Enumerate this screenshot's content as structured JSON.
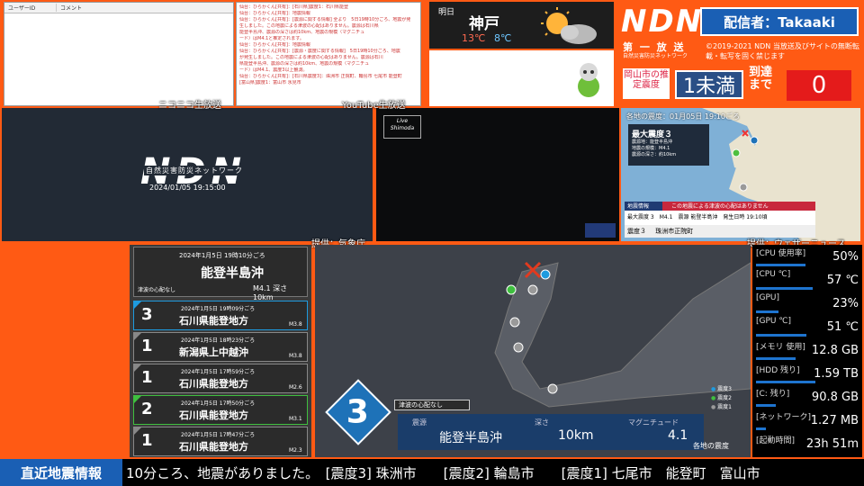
{
  "comments": {
    "col_user": "ユーザーID",
    "col_comment": "コメント"
  },
  "log": [
    "仙台：ひらかくん[共有]：[石川県]震度1：石川県能登",
    "仙台：ひらかくん[共有]：地震情報",
    "仙台：ひらかくん[共有]：[震源に関する情報] 全より　5日19時10分ごろ、地震が発",
    "生しました。この地震による津波の心配はありません。震源は石川県",
    "能登半島沖、震源の深さは約10km、地震の規模（マグニチュ",
    "ード）はM4.1と推定されます。",
    "仙台：ひらかくん[共有]：地震情報",
    "仙台：ひらかくん[共有]：[震源・震度に関する情報]　5日19時10分ごろ、地震",
    "が発生しました。この地震による津波の心配はありません。震源は石川",
    "県能登半島沖、震源の深さは約10km、地震の規模（マグニチュ",
    "ード）はM4.1、震度3以上観測。",
    "仙台：ひらかくん[共有]：[石川県震度3]：珠洲市 正院町、輪島市 七尾市 能登町",
    "[富山県]震度1：富山市 氷見市"
  ],
  "weather": {
    "day": "明日",
    "city": "神戸",
    "high": "13℃",
    "low": "8℃",
    "icon": "sun-cloud-icon"
  },
  "brand": {
    "logo": "NDN",
    "caster": "配信者：Takaaki",
    "daiichi": "第 一 放 送",
    "daiichi_sub": "自然災害防災ネットワーク",
    "copyright": "©2019-2021 NDN 当放送及びサイトの無断転載・転写を固く禁じます",
    "pref_label": "岡山市の推定震度",
    "est_intensity": "1未満",
    "arrival_label": "到達まで",
    "arrival_count": "0"
  },
  "labels": {
    "niconico": "ニコニコ生放送",
    "youtube": "YouTube生放送",
    "jma_credit": "提供：気象庁",
    "wni_credit": "提供：ウェザーニュース"
  },
  "niconico": {
    "logo": "NDN",
    "subtitle": "自然災害防災ネットワーク",
    "datetime": "2024/01/05 19:15:00"
  },
  "youtube": {
    "badge": "Live Shimoda"
  },
  "map": {
    "title": "各地の震度：01月05日 19:10ごろ",
    "max_label": "最大震度３",
    "epicenter": "震源地：能登半島沖",
    "magnitude": "地震の規模：M4.1",
    "depth": "震源の深さ：約10km",
    "ticker_head": "地震情報",
    "ticker_msg": "この地震による津波の心配はありません",
    "ticker_detail": "最大震度 3　M4.1　震源 能登半島沖　発生日時 19:10頃",
    "foot_intensity": "震度３",
    "foot_place": "珠洲市正院町"
  },
  "qlist": {
    "top": {
      "date": "2024年1月5日 19時10分ごろ",
      "name": "能登半島沖",
      "tsunami": "津波の心配なし",
      "mag": "M4.1 深さ10km"
    },
    "items": [
      {
        "int": "3",
        "time": "2024年1月5日 19時09分ごろ",
        "place": "石川県能登地方",
        "mag": "M3.8",
        "color": "#1e9bdf"
      },
      {
        "int": "1",
        "time": "2024年1月5日 18時23分ごろ",
        "place": "新潟県上中越沖",
        "mag": "M3.8",
        "color": "#888888"
      },
      {
        "int": "1",
        "time": "2024年1月5日 17時59分ごろ",
        "place": "石川県能登地方",
        "mag": "M2.6",
        "color": "#888888"
      },
      {
        "int": "2",
        "time": "2024年1月5日 17時50分ごろ",
        "place": "石川県能登地方",
        "mag": "M3.1",
        "color": "#3fbf3f"
      },
      {
        "int": "1",
        "time": "2024年1月5日 17時47分ごろ",
        "place": "石川県能登地方",
        "mag": "M2.3",
        "color": "#888888"
      }
    ]
  },
  "bigmap": {
    "max_int": "3",
    "tsunami": "津波の心配なし",
    "k_epicenter": "震源",
    "epicenter": "能登半島沖",
    "k_depth": "深さ",
    "depth": "10km",
    "k_mag": "マグニチュード",
    "mag": "4.1",
    "legend": [
      "震度3",
      "震度2",
      "震度1"
    ],
    "kakuchi": "各地の震度"
  },
  "stats": [
    {
      "k": "[CPU 使用率]",
      "v": "50%",
      "level": 50
    },
    {
      "k": "[CPU ℃]",
      "v": "57 ℃",
      "level": 57
    },
    {
      "k": "[GPU]",
      "v": "23%",
      "level": 23
    },
    {
      "k": "[GPU ℃]",
      "v": "51 ℃",
      "level": 51
    },
    {
      "k": "[メモリ 使用]",
      "v": "12.8 GB",
      "level": 40
    },
    {
      "k": "[HDD 残り]",
      "v": "1.59 TB",
      "level": 60
    },
    {
      "k": "[C: 残り]",
      "v": "90.8 GB",
      "level": 20
    },
    {
      "k": "[ネットワーク]",
      "v": "1.27 MB",
      "level": 10
    },
    {
      "k": "[起動時間]",
      "v": "23h 51m",
      "level": 0
    }
  ],
  "ticker": {
    "head": "直近地震情報",
    "body": "10分ころ、地震がありました。　[震度3] 珠洲市　　[震度2] 輪島市　　[震度1] 七尾市　能登町　富山市"
  }
}
